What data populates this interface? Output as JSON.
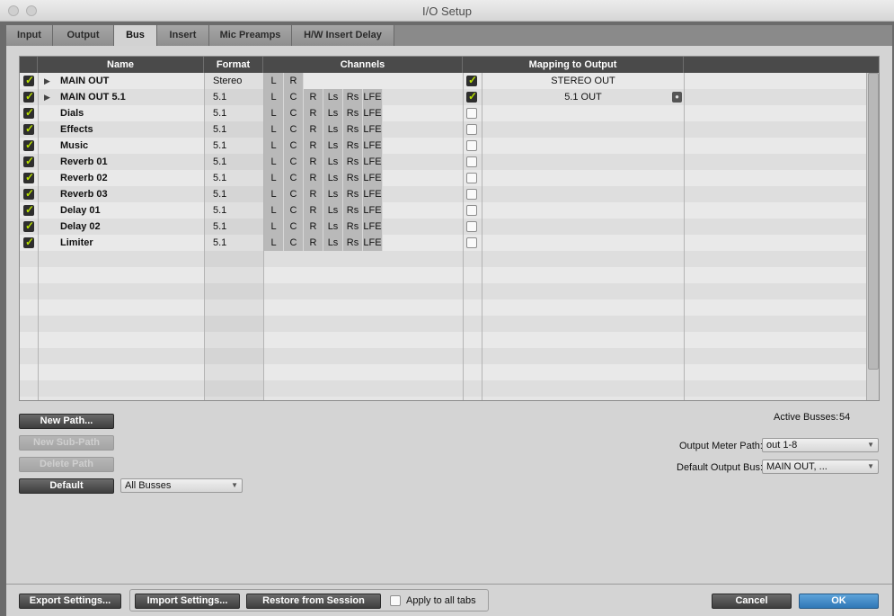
{
  "window": {
    "title": "I/O Setup"
  },
  "tabs": [
    "Input",
    "Output",
    "Bus",
    "Insert",
    "Mic Preamps",
    "H/W Insert Delay"
  ],
  "active_tab": "Bus",
  "table": {
    "headers": {
      "name": "Name",
      "format": "Format",
      "channels": "Channels",
      "mapping": "Mapping to Output"
    },
    "rows": [
      {
        "enabled": true,
        "expandable": true,
        "name": "MAIN OUT",
        "format": "Stereo",
        "channels": [
          "L",
          "R"
        ],
        "mapped": true,
        "output": "STEREO OUT",
        "lock": false
      },
      {
        "enabled": true,
        "expandable": true,
        "name": "MAIN OUT 5.1",
        "format": "5.1",
        "channels": [
          "L",
          "C",
          "R",
          "Ls",
          "Rs",
          "LFE"
        ],
        "mapped": true,
        "output": "5.1 OUT",
        "lock": true
      },
      {
        "enabled": true,
        "expandable": false,
        "name": "Dials",
        "format": "5.1",
        "channels": [
          "L",
          "C",
          "R",
          "Ls",
          "Rs",
          "LFE"
        ],
        "mapped": false,
        "output": "",
        "lock": false
      },
      {
        "enabled": true,
        "expandable": false,
        "name": "Effects",
        "format": "5.1",
        "channels": [
          "L",
          "C",
          "R",
          "Ls",
          "Rs",
          "LFE"
        ],
        "mapped": false,
        "output": "",
        "lock": false
      },
      {
        "enabled": true,
        "expandable": false,
        "name": "Music",
        "format": "5.1",
        "channels": [
          "L",
          "C",
          "R",
          "Ls",
          "Rs",
          "LFE"
        ],
        "mapped": false,
        "output": "",
        "lock": false
      },
      {
        "enabled": true,
        "expandable": false,
        "name": "Reverb 01",
        "format": "5.1",
        "channels": [
          "L",
          "C",
          "R",
          "Ls",
          "Rs",
          "LFE"
        ],
        "mapped": false,
        "output": "",
        "lock": false
      },
      {
        "enabled": true,
        "expandable": false,
        "name": "Reverb 02",
        "format": "5.1",
        "channels": [
          "L",
          "C",
          "R",
          "Ls",
          "Rs",
          "LFE"
        ],
        "mapped": false,
        "output": "",
        "lock": false
      },
      {
        "enabled": true,
        "expandable": false,
        "name": "Reverb 03",
        "format": "5.1",
        "channels": [
          "L",
          "C",
          "R",
          "Ls",
          "Rs",
          "LFE"
        ],
        "mapped": false,
        "output": "",
        "lock": false
      },
      {
        "enabled": true,
        "expandable": false,
        "name": "Delay 01",
        "format": "5.1",
        "channels": [
          "L",
          "C",
          "R",
          "Ls",
          "Rs",
          "LFE"
        ],
        "mapped": false,
        "output": "",
        "lock": false
      },
      {
        "enabled": true,
        "expandable": false,
        "name": "Delay 02",
        "format": "5.1",
        "channels": [
          "L",
          "C",
          "R",
          "Ls",
          "Rs",
          "LFE"
        ],
        "mapped": false,
        "output": "",
        "lock": false
      },
      {
        "enabled": true,
        "expandable": false,
        "name": "Limiter",
        "format": "5.1",
        "channels": [
          "L",
          "C",
          "R",
          "Ls",
          "Rs",
          "LFE"
        ],
        "mapped": false,
        "output": "",
        "lock": false
      }
    ]
  },
  "buttons": {
    "new_path": "New Path...",
    "new_sub_path": "New Sub-Path",
    "delete_path": "Delete Path",
    "default": "Default",
    "export": "Export Settings...",
    "import": "Import Settings...",
    "restore": "Restore from Session",
    "cancel": "Cancel",
    "ok": "OK"
  },
  "filter": {
    "value": "All Busses"
  },
  "active_busses": {
    "label": "Active Busses:",
    "value": "54"
  },
  "output_meter_path": {
    "label": "Output Meter Path:",
    "value": "out 1-8"
  },
  "default_output_bus": {
    "label": "Default Output Bus:",
    "value": "MAIN OUT, ..."
  },
  "apply_all": {
    "label": "Apply to all tabs",
    "checked": false
  },
  "icons": {
    "expand": "disclosure-triangle-icon",
    "lock": "lock-icon"
  },
  "colors": {
    "check_mark": "#b8e000",
    "ok_button": "#3a86c8",
    "header_bg": "#4a4a4a"
  }
}
